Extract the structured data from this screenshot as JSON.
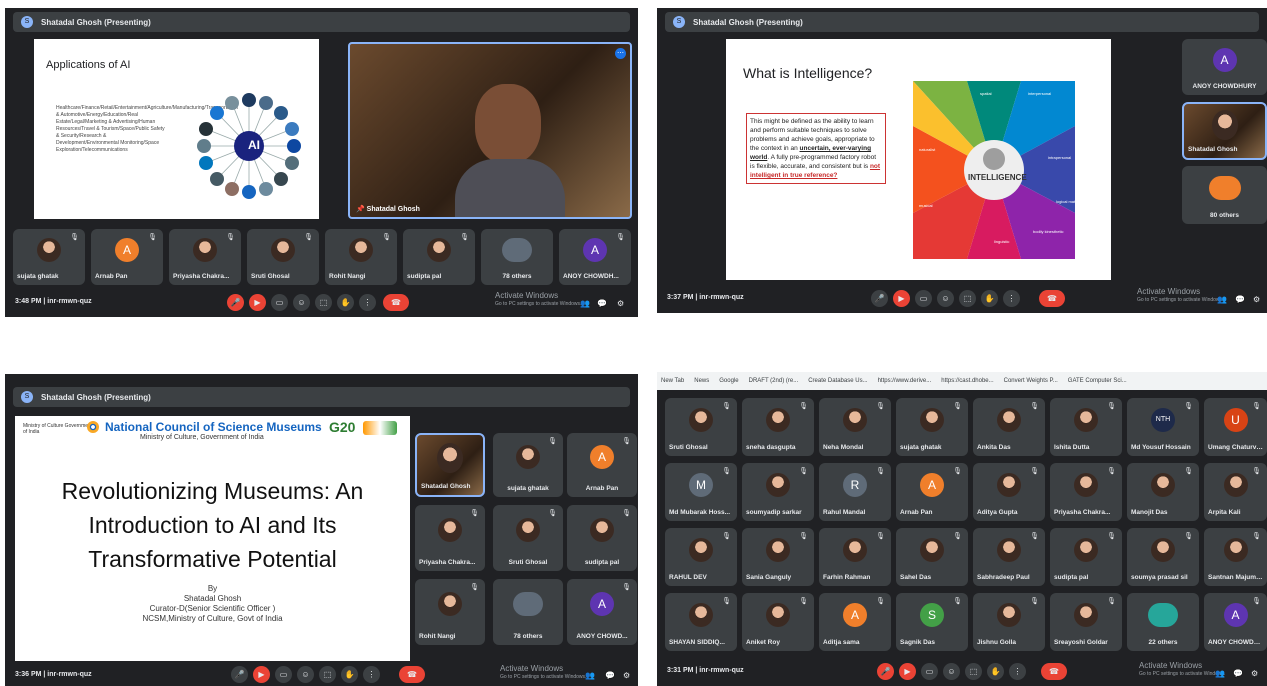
{
  "q1": {
    "presenter": "Shatadal Ghosh (Presenting)",
    "slide_title": "Applications of AI",
    "slide_body": "Healthcare/Finance/Retail/Entertainment/Agriculture/Manufacturing/Transportation & Automotive/Energy/Education/Real Estate/Legal/Marketing & Advertising/Human Resources/Travel & Tourism/Space/Public Safety & Security/Research & Development/Environmental Monitoring/Space Exploration/Telecommunications",
    "ai_hub": "AI",
    "speaker_name": "Shatadal Ghosh",
    "tiles": [
      {
        "name": "sujata ghatak"
      },
      {
        "name": "Arnab Pan",
        "initial": "A"
      },
      {
        "name": "Priyasha Chakra..."
      },
      {
        "name": "Sruti Ghosal"
      },
      {
        "name": "Rohit Nangi"
      },
      {
        "name": "sudipta pal"
      },
      {
        "name": "78 others"
      },
      {
        "name": "ANOY CHOWDH...",
        "initial": "A"
      }
    ],
    "time": "3:48 PM | inr-rmwn-quz",
    "activate_title": "Activate Windows",
    "activate_sub": "Go to PC settings to activate Windows."
  },
  "q2": {
    "presenter": "Shatadal Ghosh (Presenting)",
    "slide_title": "What is Intelligence?",
    "slide_body_1": "This might be defined as the ability to learn and perform suitable techniques to solve problems and achieve goals, appropriate to the context in an ",
    "slide_body_bold": "uncertain, ever-varying world",
    "slide_body_2": ". A fully pre-programmed factory robot is flexible, accurate, and consistent but is ",
    "slide_body_red": "not intelligent in true reference?",
    "wheel_center": "INTELLIGENCE",
    "wheel_labels": [
      "spatial",
      "interpersonal",
      "intrapersonal",
      "bodily kinesthetic",
      "logical mathematical",
      "linguistic",
      "musical",
      "naturalist"
    ],
    "tiles": [
      {
        "name": "ANOY CHOWDHURY",
        "initial": "A"
      },
      {
        "name": "Shatadal Ghosh"
      },
      {
        "name": "80 others"
      }
    ],
    "time": "3:37 PM | inr-rmwn-quz",
    "activate_title": "Activate Windows",
    "activate_sub": "Go to PC settings to activate Windows."
  },
  "q3": {
    "presenter": "Shatadal Ghosh (Presenting)",
    "ministry": "Ministry of Culture Government of India",
    "org": "National Council of Science Museums",
    "org_sub": "Ministry of Culture, Government of India",
    "g20": "G20",
    "title": "Revolutionizing Museums: An Introduction to AI and Its Transformative Potential",
    "by": "By",
    "author": "Shatadal Ghosh",
    "role": "Curator-D(Senior Scientific Officer )",
    "affil": "NCSM,Ministry of Culture, Govt of India",
    "tiles": [
      {
        "name": "Shatadal Ghosh"
      },
      {
        "name": "sujata ghatak"
      },
      {
        "name": "Arnab Pan",
        "initial": "A"
      },
      {
        "name": "Priyasha Chakra..."
      },
      {
        "name": "Sruti Ghosal"
      },
      {
        "name": "sudipta pal"
      },
      {
        "name": "Rohit Nangi"
      },
      {
        "name": "78 others"
      },
      {
        "name": "ANOY CHOWD...",
        "initial": "A"
      }
    ],
    "time": "3:36 PM | inr-rmwn-quz",
    "activate_title": "Activate Windows",
    "activate_sub": "Go to PC settings to activate Windows."
  },
  "q4": {
    "tabs": [
      "New Tab",
      "News",
      "Google",
      "DRAFT (2nd) (re...",
      "Create Database Us...",
      "https://www.derive...",
      "https://cast.dhobe...",
      "Convert Weights P...",
      "GATE Computer Sci..."
    ],
    "tiles": [
      {
        "name": "Sruti Ghosal"
      },
      {
        "name": "sneha dasgupta"
      },
      {
        "name": "Neha Mondal"
      },
      {
        "name": "sujata ghatak"
      },
      {
        "name": "Ankita Das"
      },
      {
        "name": "Ishita Dutta"
      },
      {
        "name": "Md Yousuf Hossain",
        "initial": "NTH"
      },
      {
        "name": "Umang Chaturve...",
        "initial": "U"
      },
      {
        "name": "Md Mubarak Hoss...",
        "initial": "M"
      },
      {
        "name": "soumyadip sarkar"
      },
      {
        "name": "Rahul Mandal",
        "initial": "R"
      },
      {
        "name": "Arnab Pan",
        "initial": "A"
      },
      {
        "name": "Aditya Gupta"
      },
      {
        "name": "Priyasha Chakra..."
      },
      {
        "name": "Manojit Das"
      },
      {
        "name": "Arpita Kali"
      },
      {
        "name": "RAHUL DEV"
      },
      {
        "name": "Sania Ganguly"
      },
      {
        "name": "Farhin Rahman"
      },
      {
        "name": "Sahel Das"
      },
      {
        "name": "Sabhradeep Paul"
      },
      {
        "name": "sudipta pal"
      },
      {
        "name": "soumya prasad sil"
      },
      {
        "name": "Santnan Majumd..."
      },
      {
        "name": "SHAYAN SIDDIQ..."
      },
      {
        "name": "Aniket Roy"
      },
      {
        "name": "Aditja sama",
        "initial": "A"
      },
      {
        "name": "Sagnik Das",
        "initial": "S"
      },
      {
        "name": "Jishnu Golla"
      },
      {
        "name": "Sreayoshi Goldar"
      },
      {
        "name": "22 others"
      },
      {
        "name": "ANOY CHOWDH...",
        "initial": "A"
      }
    ],
    "time": "3:31 PM | inr-rmwn-quz",
    "activate_title": "Activate Windows",
    "activate_sub": "Go to PC settings to activate Windows."
  },
  "icons": [
    "mic-icon",
    "camera-icon",
    "captions-icon",
    "emoji-icon",
    "present-icon",
    "hand-icon",
    "more-icon",
    "end-call-icon"
  ]
}
